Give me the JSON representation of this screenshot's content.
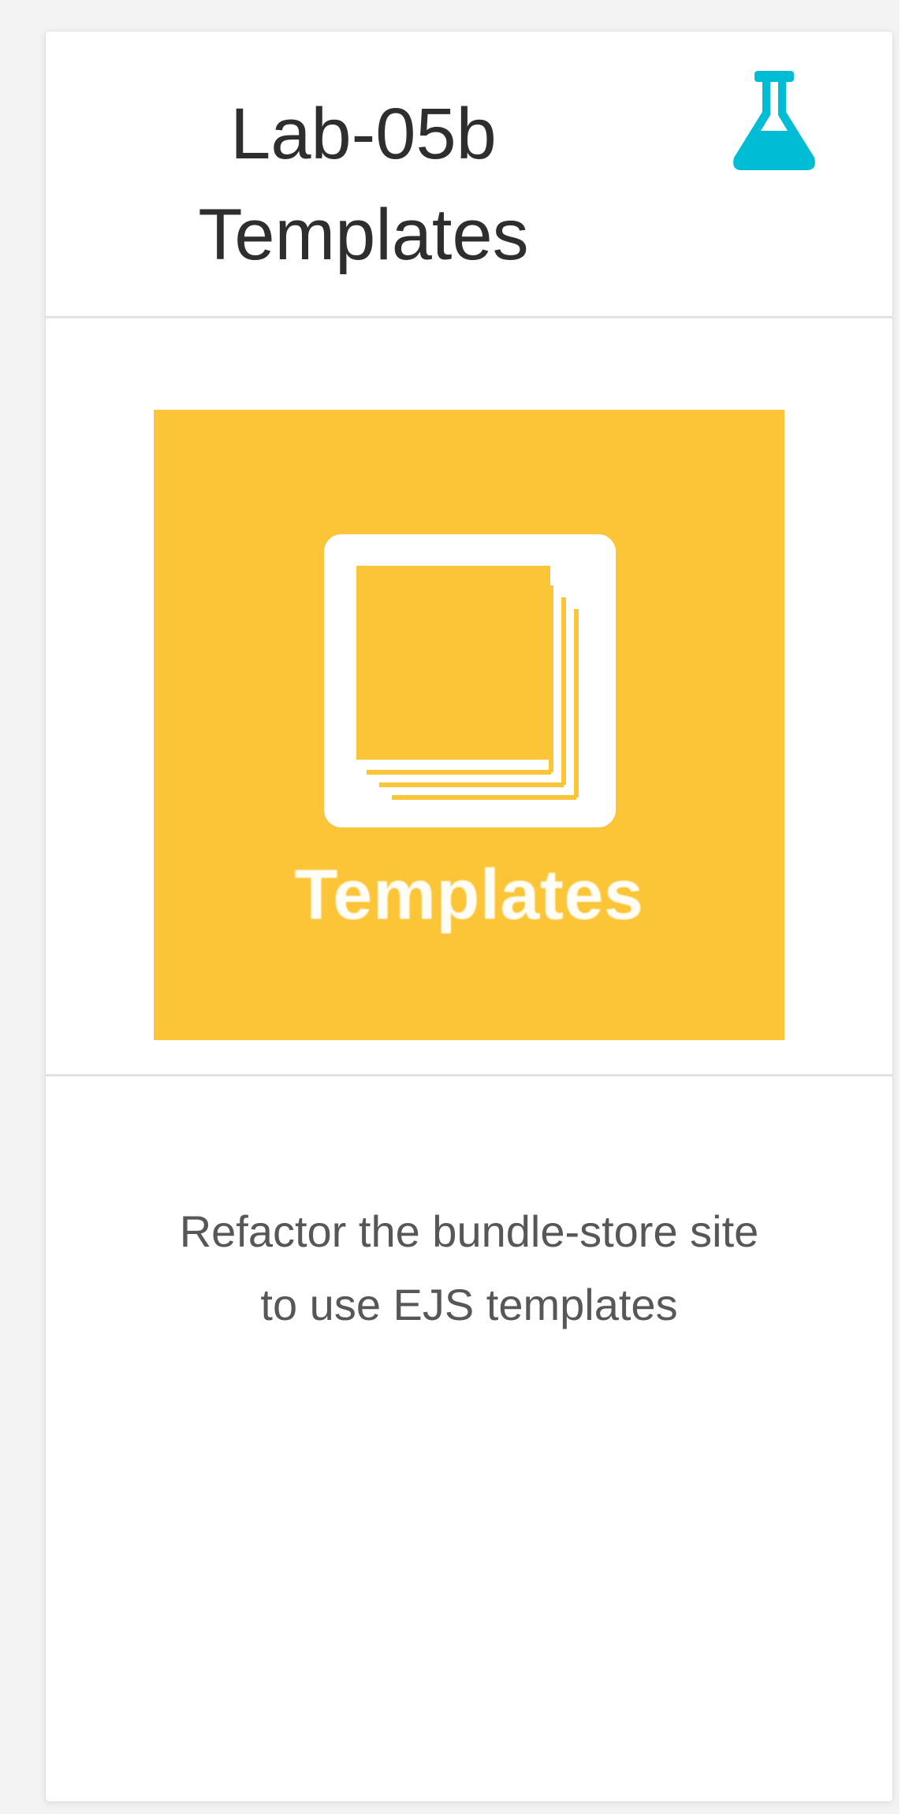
{
  "card": {
    "title_line1": "Lab-05b",
    "title_line2": "Templates",
    "type_icon": "flask-icon",
    "image": {
      "label": "Templates",
      "icon": "stacked-pages-icon",
      "background_color": "#fcc537"
    },
    "description_line1": "Refactor the bundle-store site",
    "description_line2": "to use EJS templates"
  },
  "colors": {
    "icon_accent": "#00bcd4",
    "title_text": "#2e2e2e",
    "description_text": "#575757"
  }
}
